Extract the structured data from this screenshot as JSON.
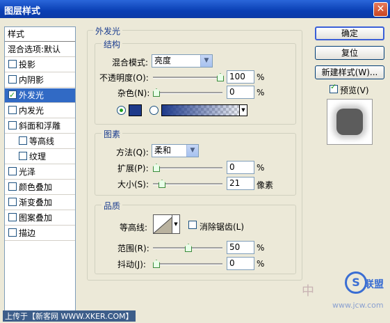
{
  "window": {
    "title": "图层样式",
    "close_icon": "close-icon"
  },
  "sidebar": {
    "header": "样式",
    "items": [
      {
        "label": "混合选项:默认",
        "checkbox": false,
        "indent": false,
        "selected": false
      },
      {
        "label": "投影",
        "checkbox": true,
        "checked": false,
        "indent": false,
        "selected": false
      },
      {
        "label": "内阴影",
        "checkbox": true,
        "checked": false,
        "indent": false,
        "selected": false
      },
      {
        "label": "外发光",
        "checkbox": true,
        "checked": true,
        "indent": false,
        "selected": true
      },
      {
        "label": "内发光",
        "checkbox": true,
        "checked": false,
        "indent": false,
        "selected": false
      },
      {
        "label": "斜面和浮雕",
        "checkbox": true,
        "checked": false,
        "indent": false,
        "selected": false
      },
      {
        "label": "等高线",
        "checkbox": true,
        "checked": false,
        "indent": true,
        "selected": false
      },
      {
        "label": "纹理",
        "checkbox": true,
        "checked": false,
        "indent": true,
        "selected": false
      },
      {
        "label": "光泽",
        "checkbox": true,
        "checked": false,
        "indent": false,
        "selected": false
      },
      {
        "label": "颜色叠加",
        "checkbox": true,
        "checked": false,
        "indent": false,
        "selected": false
      },
      {
        "label": "渐变叠加",
        "checkbox": true,
        "checked": false,
        "indent": false,
        "selected": false
      },
      {
        "label": "图案叠加",
        "checkbox": true,
        "checked": false,
        "indent": false,
        "selected": false
      },
      {
        "label": "描边",
        "checkbox": true,
        "checked": false,
        "indent": false,
        "selected": false
      }
    ]
  },
  "panel": {
    "title": "外发光",
    "structure": {
      "title": "结构",
      "blend_mode_label": "混合模式:",
      "blend_mode_value": "亮度",
      "opacity_label": "不透明度(O):",
      "opacity_value": "100",
      "opacity_unit": "%",
      "opacity_level": 1.0,
      "noise_label": "杂色(N):",
      "noise_value": "0",
      "noise_unit": "%",
      "noise_level": 0.0,
      "glow_color": "#1e3a8a",
      "color_mode": "solid"
    },
    "elements": {
      "title": "图素",
      "method_label": "方法(Q):",
      "method_value": "柔和",
      "spread_label": "扩展(P):",
      "spread_value": "0",
      "spread_unit": "%",
      "spread_level": 0.0,
      "size_label": "大小(S):",
      "size_value": "21",
      "size_unit": "像素",
      "size_level": 0.085
    },
    "quality": {
      "title": "品质",
      "contour_label": "等高线:",
      "antialias_label": "消除锯齿(L)",
      "antialias_checked": false,
      "range_label": "范围(R):",
      "range_value": "50",
      "range_unit": "%",
      "range_level": 0.5,
      "jitter_label": "抖动(J):",
      "jitter_value": "0",
      "jitter_unit": "%",
      "jitter_level": 0.0
    }
  },
  "buttons": {
    "ok": "确定",
    "reset": "复位",
    "new_style": "新建样式(W)...",
    "preview_label": "预览(V)",
    "preview_checked": true
  },
  "footer": {
    "text": "上传于【新客网 WWW.XKER.COM】"
  },
  "watermark": {
    "t1": "中",
    "circle": "S",
    "t2": "联盟",
    "t3": "www.jcw.com"
  },
  "colors": {
    "accent": "#316ac5",
    "group_title": "#1b3d8f"
  }
}
